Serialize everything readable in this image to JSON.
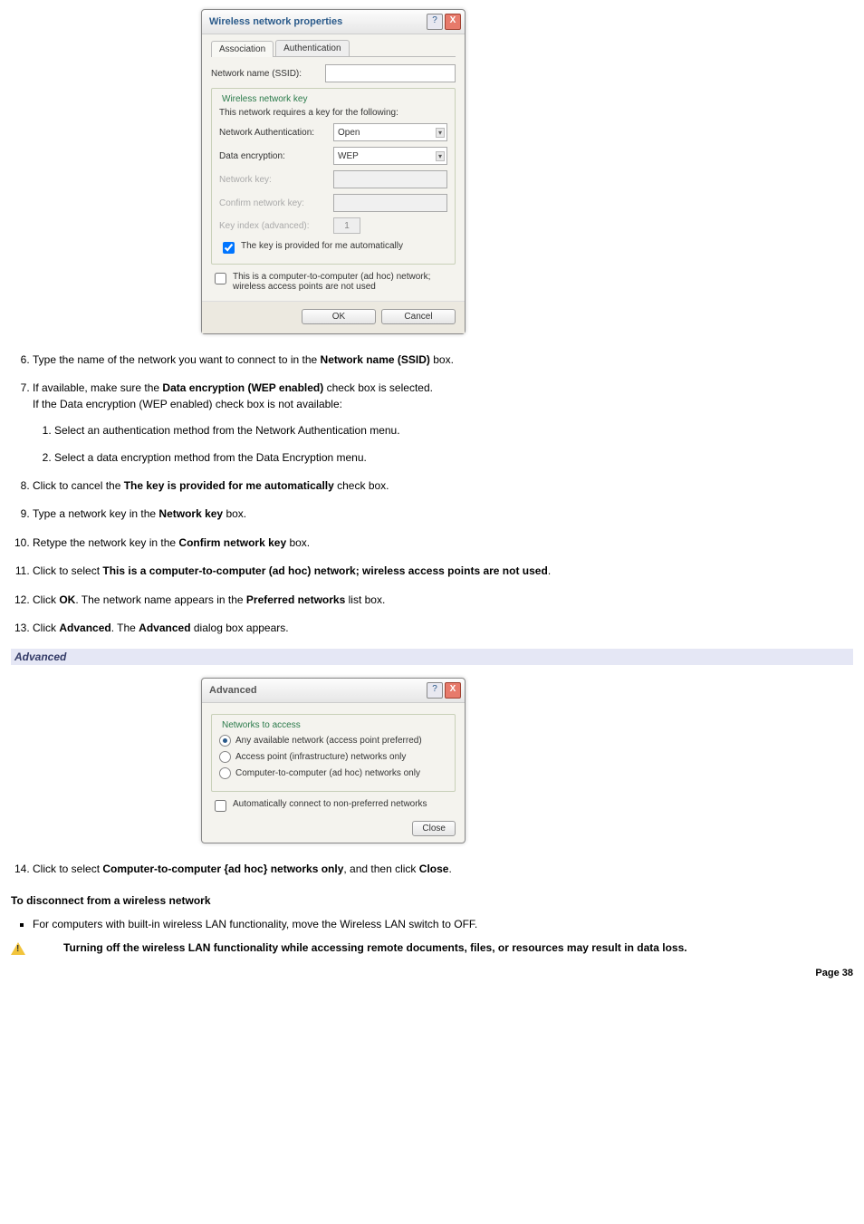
{
  "dialog1": {
    "title": "Wireless network properties",
    "tabs": {
      "association": "Association",
      "authentication": "Authentication"
    },
    "ssid_label": "Network name (SSID):",
    "fieldset_legend": "Wireless network key",
    "fieldset_intro": "This network requires a key for the following:",
    "auth_label": "Network Authentication:",
    "auth_value": "Open",
    "enc_label": "Data encryption:",
    "enc_value": "WEP",
    "key_label": "Network key:",
    "confirm_label": "Confirm network key:",
    "index_label": "Key index (advanced):",
    "index_value": "1",
    "auto_key_label": "The key is provided for me automatically",
    "adhoc_label": "This is a computer-to-computer (ad hoc) network; wireless access points are not used",
    "ok": "OK",
    "cancel": "Cancel"
  },
  "dialog2": {
    "title": "Advanced",
    "fieldset_legend": "Networks to access",
    "opt1": "Any available network (access point preferred)",
    "opt2": "Access point (infrastructure) networks only",
    "opt3": "Computer-to-computer (ad hoc) networks only",
    "auto_connect": "Automatically connect to non-preferred networks",
    "close": "Close"
  },
  "steps": {
    "s6": {
      "pre": "Type the name of the network you want to connect to in the ",
      "b": "Network name (SSID)",
      "post": " box."
    },
    "s7": {
      "l1_pre": "If available, make sure the ",
      "l1_b": "Data encryption (WEP enabled)",
      "l1_post": " check box is selected.",
      "l2": "If the Data encryption (WEP enabled) check box is not available:",
      "sub1": "Select an authentication method from the Network Authentication menu.",
      "sub2": "Select a data encryption method from the Data Encryption menu."
    },
    "s8": {
      "pre": "Click to cancel the ",
      "b": "The key is provided for me automatically",
      "post": " check box."
    },
    "s9": {
      "pre": "Type a network key in the ",
      "b": "Network key",
      "post": " box."
    },
    "s10": {
      "pre": "Retype the network key in the ",
      "b": "Confirm network key",
      "post": " box."
    },
    "s11": {
      "pre": "Click to select ",
      "b": "This is a computer-to-computer (ad hoc) network; wireless access points are not used",
      "post": "."
    },
    "s12": {
      "pre": "Click ",
      "b1": "OK",
      "mid": ". The network name appears in the ",
      "b2": "Preferred networks",
      "post": " list box."
    },
    "s13": {
      "pre": "Click ",
      "b1": "Advanced",
      "mid": ". The ",
      "b2": "Advanced",
      "post": " dialog box appears."
    },
    "s14": {
      "pre": "Click to select ",
      "b1": "Computer-to-computer {ad hoc} networks only",
      "mid": ", and then click ",
      "b2": "Close",
      "post": "."
    }
  },
  "advanced_heading": "Advanced",
  "disconnect_heading": "To disconnect from a wireless network",
  "disconnect_bullet": "For computers with built-in wireless LAN functionality, move the Wireless LAN switch to OFF.",
  "warning_text": "Turning off the wireless LAN functionality while accessing remote documents, files, or resources may result in data loss.",
  "page_footer": "Page 38"
}
